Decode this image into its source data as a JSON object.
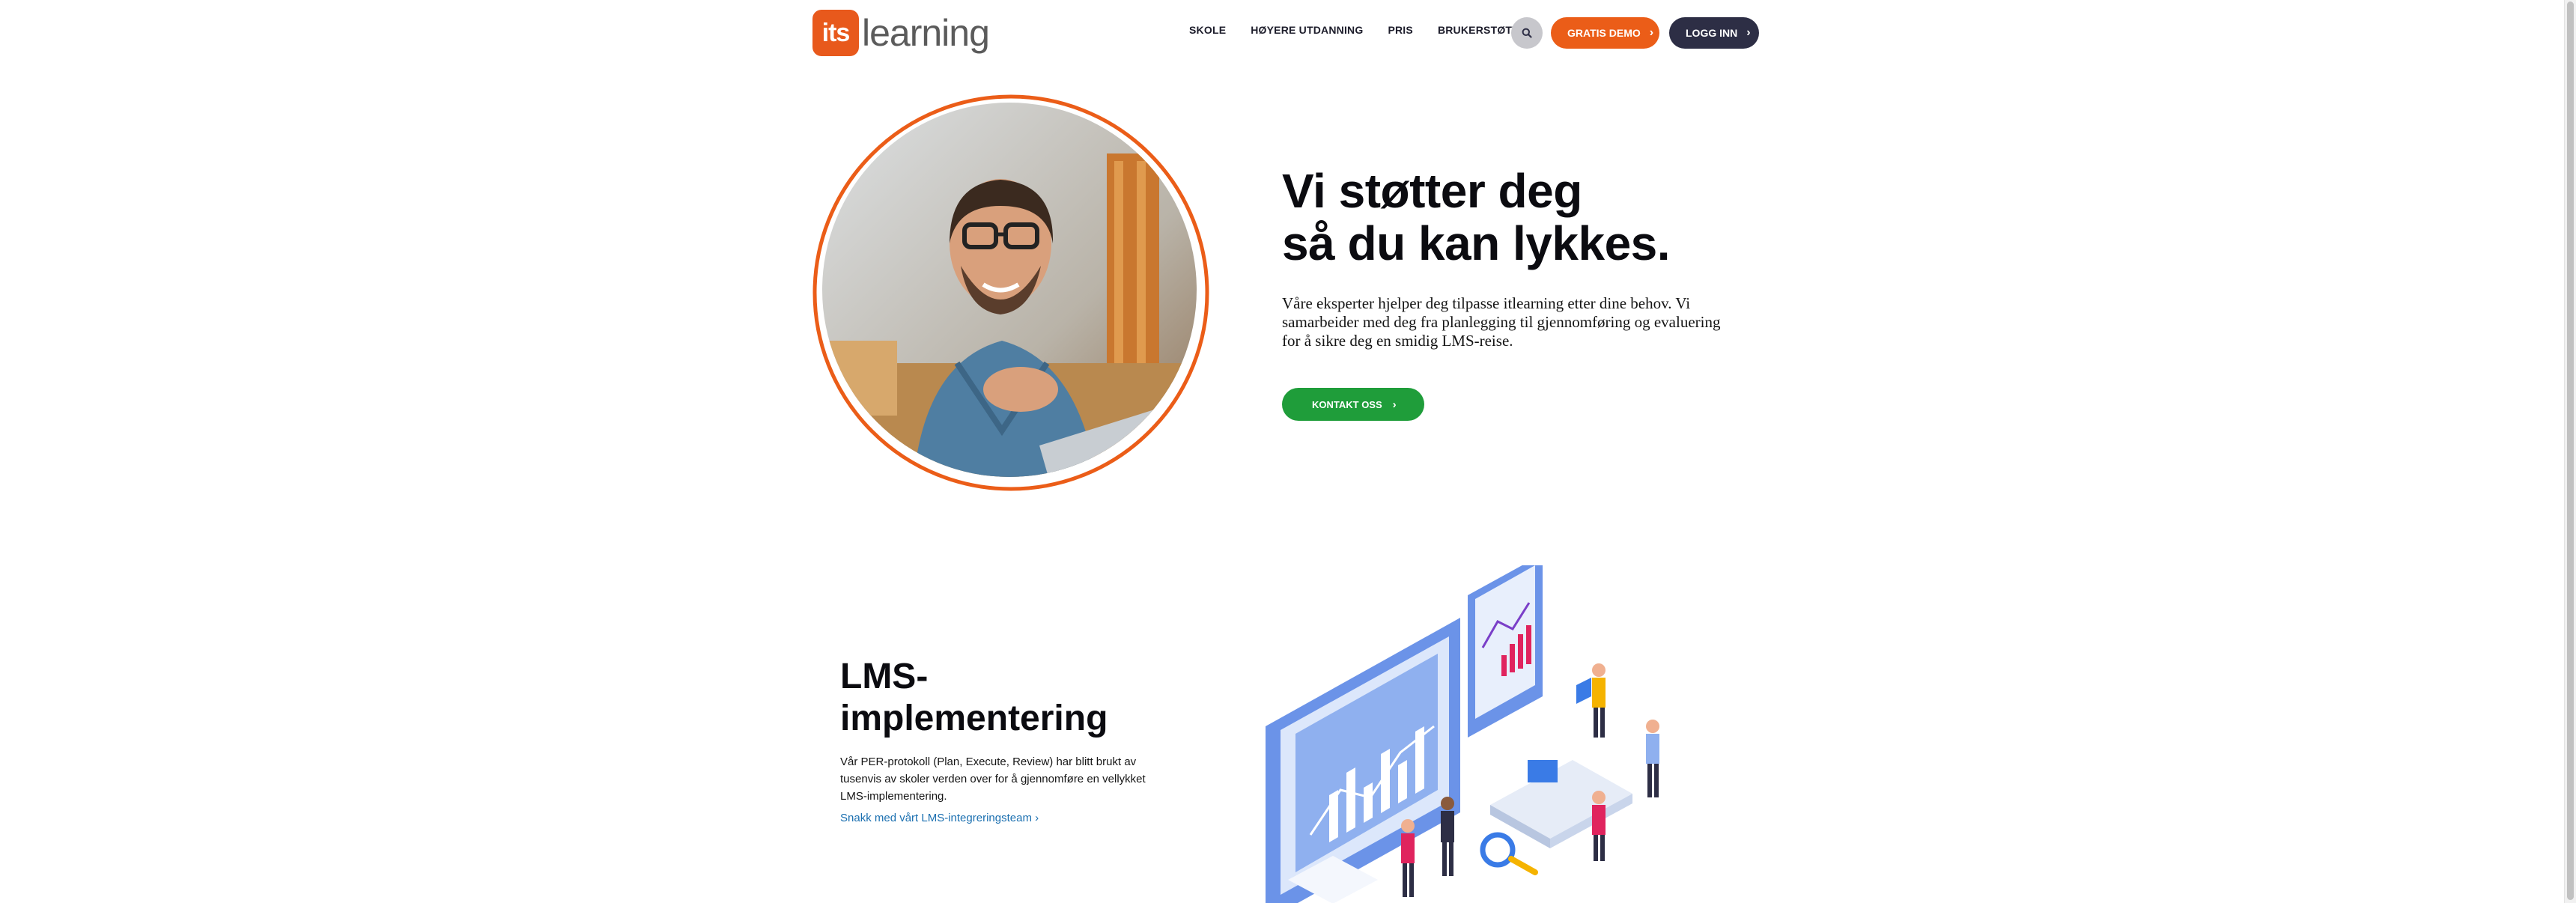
{
  "brand": {
    "logo_box_text": "its",
    "logo_word": "learning",
    "logo_color": "#e8591c"
  },
  "nav": {
    "items": [
      {
        "label": "SKOLE"
      },
      {
        "label": "HØYERE UTDANNING"
      },
      {
        "label": "PRIS"
      },
      {
        "label": "BRUKERSTØTTE"
      }
    ],
    "search_icon": "search-icon",
    "demo_label": "GRATIS DEMO",
    "login_label": "LOGG INN"
  },
  "hero": {
    "title_line1": "Vi støtter deg",
    "title_line2": "så du kan lykkes.",
    "description": "Våre eksperter hjelper deg tilpasse itlearning etter dine behov. Vi samarbeider med deg fra planlegging til gjennomføring og evaluering for å sikre deg en smidig LMS-reise.",
    "cta_label": "KONTAKT OSS",
    "accent_color": "#eb5d18",
    "cta_color": "#1f9d3a"
  },
  "lms": {
    "title_line1": "LMS-",
    "title_line2": "implementering",
    "description": "Vår PER-protokoll (Plan, Execute, Review) har blitt brukt av tusenvis av skoler verden over for å gjennomføre en vellykket LMS-implementering.",
    "link_label": "Snakk med vårt LMS-integreringsteam ›"
  },
  "colors": {
    "dark_button": "#2d2e45",
    "link": "#1a6fb0"
  }
}
